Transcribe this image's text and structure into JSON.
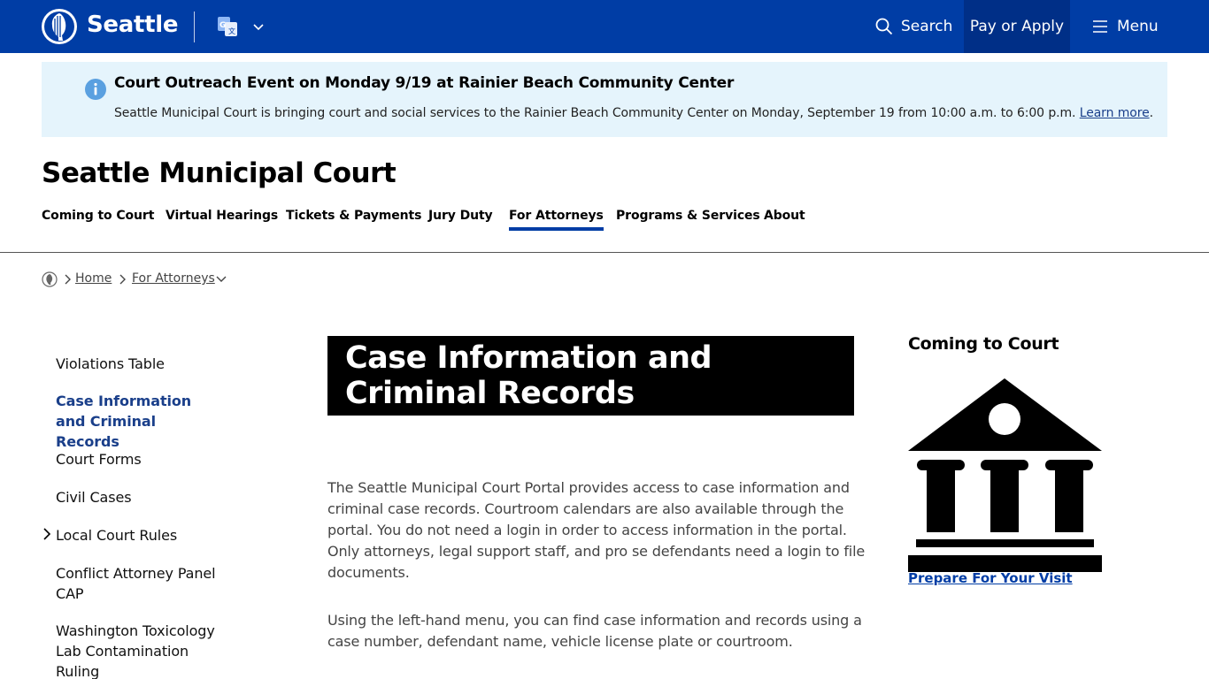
{
  "header": {
    "brand": "Seattle",
    "search_label": "Search",
    "pay_label": "Pay or Apply",
    "menu_label": "Menu",
    "accent_color": "#003DA5"
  },
  "alert": {
    "title": "Court Outreach Event on Monday 9/19 at Rainier Beach Community Center",
    "body": "Seattle Municipal Court is bringing court and social services to the Rainier Beach Community Center on Monday, September 19 from 10:00 a.m. to 6:00 p.m.",
    "link_label": "Learn more",
    "trailing": ".",
    "background": "#E5F4FC"
  },
  "site": {
    "title": "Seattle Municipal Court"
  },
  "nav": {
    "items": [
      {
        "label": "Coming to Court"
      },
      {
        "label": "Virtual Hearings"
      },
      {
        "label": "Tickets & Payments"
      },
      {
        "label": "Jury Duty"
      },
      {
        "label": "For Attorneys",
        "active": true
      },
      {
        "label": "Programs & Services"
      },
      {
        "label": "About"
      }
    ]
  },
  "breadcrumb": {
    "home": "Home",
    "section": "For Attorneys"
  },
  "leftnav": {
    "items": [
      {
        "label": "Violations Table"
      },
      {
        "label": "Case Information and Criminal Records",
        "current": true
      },
      {
        "label": "Court Forms"
      },
      {
        "label": "Civil Cases"
      },
      {
        "label": "Local Court Rules",
        "expandable": true
      },
      {
        "label": "Conflict Attorney Panel CAP"
      },
      {
        "label": "Washington Toxicology Lab Contamination Ruling"
      }
    ]
  },
  "main": {
    "title": "Case Information and Criminal Records",
    "paragraphs": [
      "The Seattle Municipal Court Portal provides access to case information and criminal case records. Courtroom calendars are also available through the portal. You do not need a login in order to access information in the portal. Only attorneys, legal support staff, and pro se defendants need a login to file documents.",
      "Using the left-hand menu, you can find case information and records using a case number, defendant name, vehicle license plate or courtroom."
    ]
  },
  "sidebar": {
    "title": "Coming to Court",
    "graphic_icon": "courthouse-icon",
    "link_label": "Prepare For Your Visit"
  }
}
